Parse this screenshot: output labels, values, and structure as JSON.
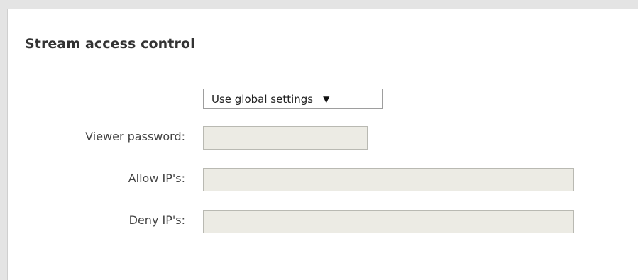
{
  "section": {
    "title": "Stream access control"
  },
  "access_mode": {
    "selected": "Use global settings"
  },
  "fields": {
    "viewer_password": {
      "label": "Viewer password:",
      "value": ""
    },
    "allow_ips": {
      "label": "Allow IP's:",
      "value": ""
    },
    "deny_ips": {
      "label": "Deny IP's:",
      "value": ""
    }
  },
  "icons": {
    "dropdown": "chevron-down-icon"
  }
}
